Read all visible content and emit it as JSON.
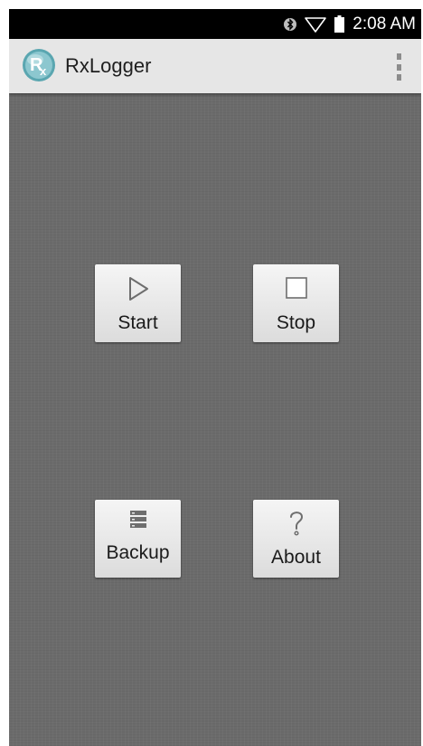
{
  "status_bar": {
    "time": "2:08 AM",
    "icons": [
      "bluetooth-icon",
      "wifi-icon",
      "battery-icon"
    ]
  },
  "action_bar": {
    "title": "RxLogger",
    "logo_icon": "rx-logo-icon",
    "menu_icon": "overflow-menu-icon"
  },
  "buttons": {
    "start": {
      "label": "Start",
      "icon": "play-icon"
    },
    "stop": {
      "label": "Stop",
      "icon": "stop-icon"
    },
    "backup": {
      "label": "Backup",
      "icon": "backup-icon"
    },
    "about": {
      "label": "About",
      "icon": "help-icon"
    }
  },
  "colors": {
    "status_bar": "#000000",
    "action_bar": "#e6e6e6",
    "background": "#6b6b6b",
    "logo_teal": "#6fb3bc"
  }
}
